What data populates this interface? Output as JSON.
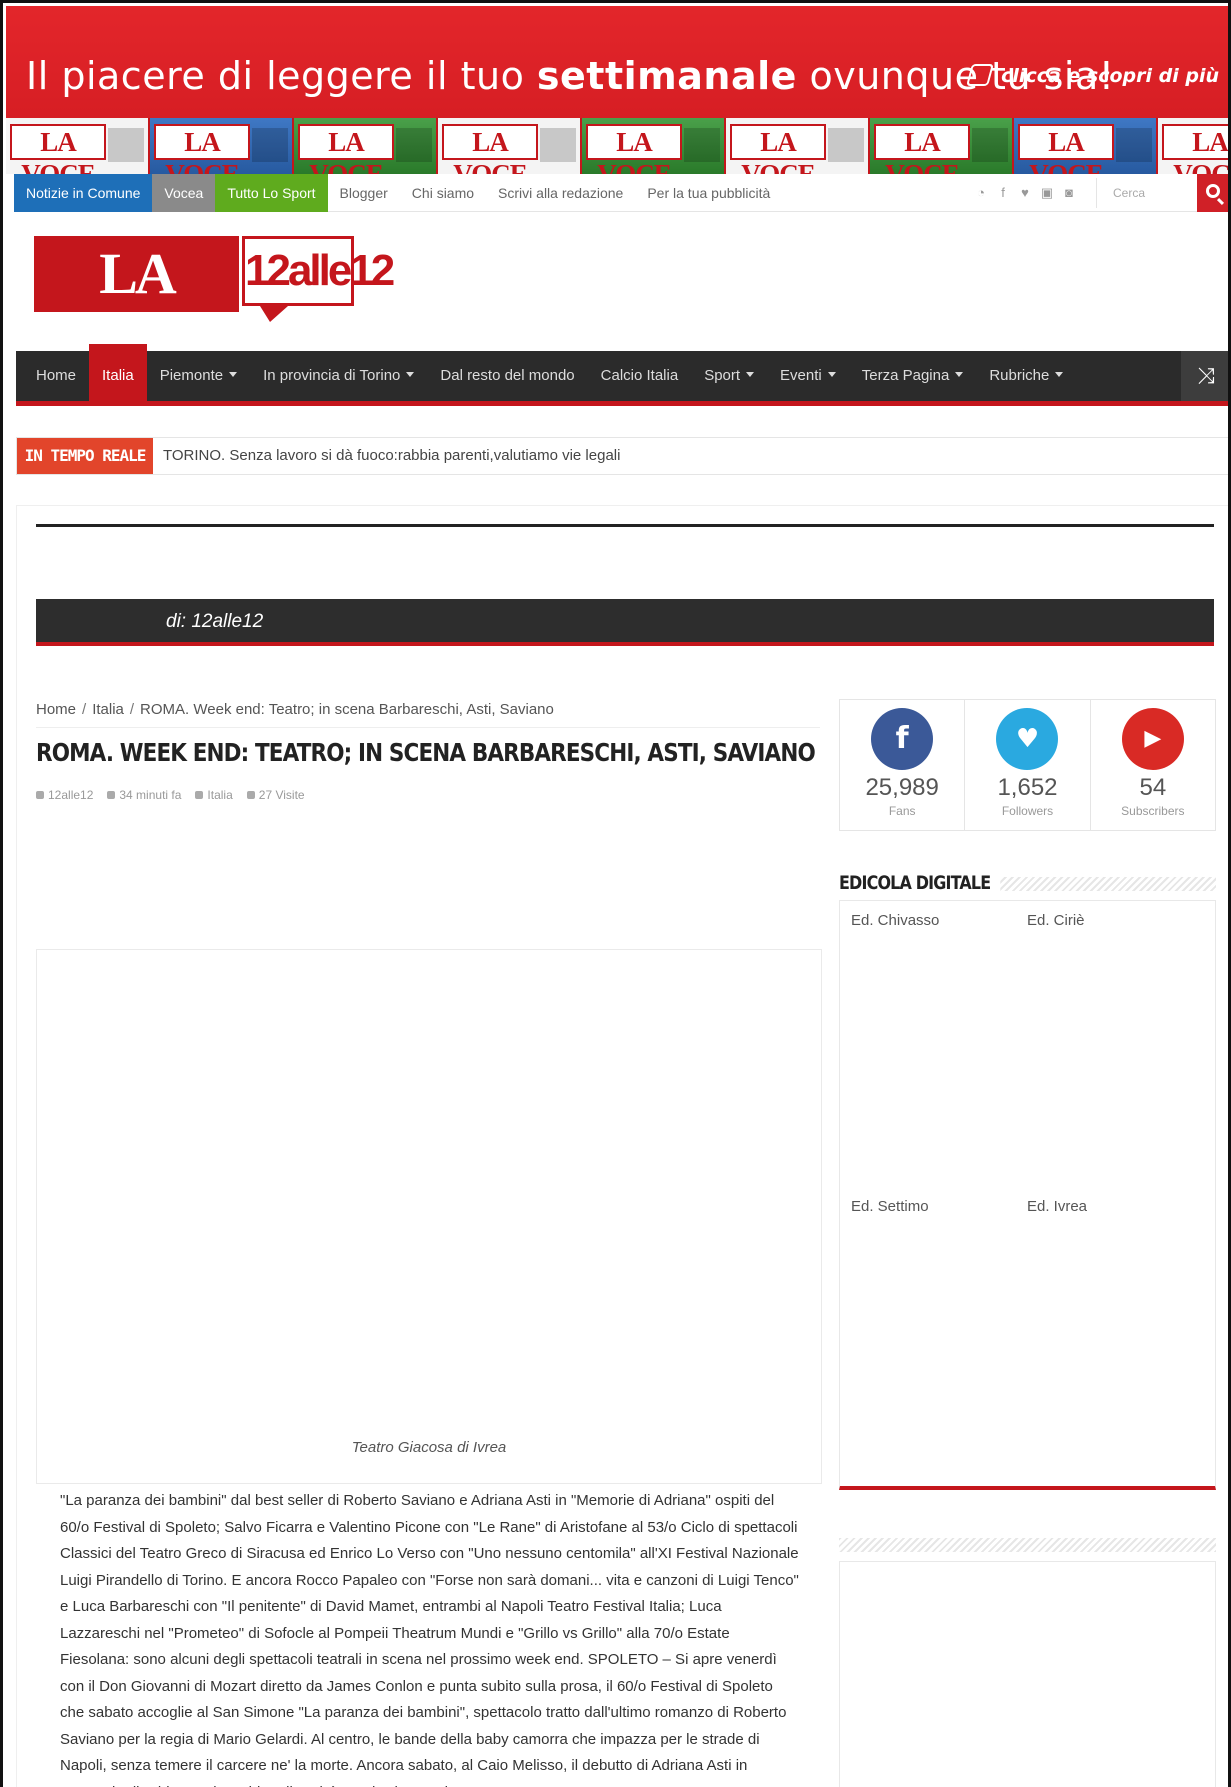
{
  "banner": {
    "text_pre": "Il piacere di leggere il tuo ",
    "text_bold": "settimanale",
    "text_post": " ovunque tu sia!",
    "cta": "clicca e scopri di più",
    "paper_masthead": "LA VOCE",
    "colors": {
      "background": "#d81e24"
    }
  },
  "topnav": {
    "items": [
      "Notizie in Comune",
      "Vocea",
      "Tutto Lo Sport",
      "Blogger",
      "Chi siamo",
      "Scrivi alla redazione",
      "Per la tua pubblicità"
    ],
    "social_icons": [
      "rss-icon",
      "facebook-icon",
      "twitter-icon",
      "youtube-icon",
      "instagram-icon"
    ],
    "search_placeholder": "Cerca"
  },
  "logo": {
    "main": "LA VOCE",
    "bubble": "12alle12"
  },
  "mainnav": {
    "items": [
      "Home",
      "Italia",
      "Piemonte",
      "In provincia di Torino",
      "Dal resto del mondo",
      "Calcio Italia",
      "Sport",
      "Eventi",
      "Terza Pagina",
      "Rubriche"
    ],
    "active": "Italia"
  },
  "breaking": {
    "label": "IN TEMPO REALE",
    "headline": "TORINO. Senza lavoro si dà fuoco:rabbia parenti,valutiamo vie legali"
  },
  "author_bar": {
    "text": "di: 12alle12"
  },
  "breadcrumb": [
    "Home",
    "Italia",
    "ROMA. Week end: Teatro; in scena Barbareschi, Asti, Saviano"
  ],
  "post": {
    "title": "ROMA. WEEK END: TEATRO; IN SCENA BARBARESCHI, ASTI, SAVIANO",
    "author": "12alle12",
    "time": "34 minuti fa",
    "category": "Italia",
    "views": "27 Visite",
    "caption": "Teatro Giacosa di Ivrea",
    "body": "\"La paranza dei bambini\" dal best seller di Roberto Saviano e Adriana Asti in \"Memorie di Adriana\" ospiti del 60/o Festival di Spoleto; Salvo Ficarra e Valentino Picone con \"Le Rane\" di Aristofane al 53/o Ciclo di spettacoli Classici del Teatro Greco di Siracusa ed Enrico Lo Verso con \"Uno nessuno centomila\" all'XI Festival Nazionale Luigi Pirandello di Torino. E ancora Rocco Papaleo con \"Forse non sarà domani... vita e canzoni di Luigi Tenco\" e Luca Barbareschi con \"Il penitente\" di David Mamet, entrambi al Napoli Teatro Festival Italia; Luca Lazzareschi nel \"Prometeo\" di Sofocle al Pompeii Theatrum Mundi e \"Grillo vs Grillo\" alla 70/o Estate Fiesolana: sono alcuni degli spettacoli teatrali in scena nel prossimo week end. SPOLETO – Si apre venerdì con il Don Giovanni di Mozart diretto da James Conlon e punta subito sulla prosa, il 60/o Festival di Spoleto che sabato accoglie al San Simone \"La paranza dei bambini\", spettacolo tratto dall'ultimo romanzo di Roberto Saviano per la regia di Mario Gelardi. Al centro, le bande della baby camorra che impazza per le strade di Napoli, senza temere il carcere ne' la morte. Ancora sabato, al Caio Melisso, il debutto di Adriana Asti in \"Memorie di Adriana\", da un'idea di Andrée Ruth Shammah, mentre"
  },
  "counters": [
    {
      "num": "25,989",
      "label": "Fans",
      "color": "#3b5998",
      "icon": "facebook-icon"
    },
    {
      "num": "1,652",
      "label": "Followers",
      "color": "#2aa9e0",
      "icon": "twitter-icon"
    },
    {
      "num": "54",
      "label": "Subscribers",
      "color": "#d92a25",
      "icon": "youtube-icon"
    }
  ],
  "edicola": {
    "title": "EDICOLA DIGITALE",
    "items": [
      "Ed. Chivasso",
      "Ed. Ciriè",
      "Ed. Settimo",
      "Ed. Ivrea"
    ]
  }
}
